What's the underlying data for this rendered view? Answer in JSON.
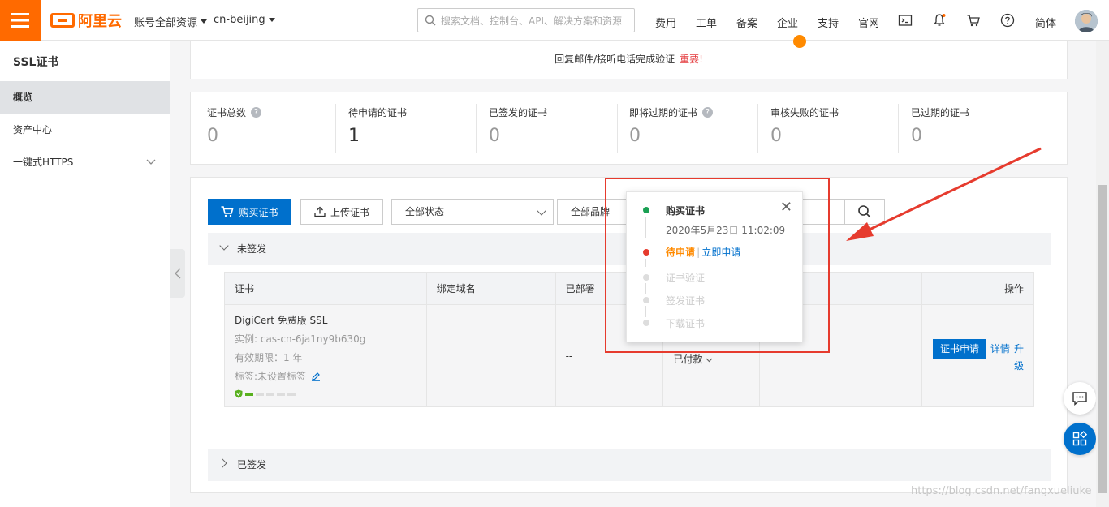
{
  "header": {
    "logo_text": "阿里云",
    "account_scope": "账号全部资源",
    "region": "cn-beijing",
    "search_placeholder": "搜索文档、控制台、API、解决方案和资源",
    "nav": [
      "费用",
      "工单",
      "备案",
      "企业",
      "支持",
      "官网"
    ],
    "language": "简体"
  },
  "sidebar": {
    "title": "SSL证书",
    "items": [
      {
        "label": "概览",
        "active": true
      },
      {
        "label": "资产中心",
        "active": false
      },
      {
        "label": "一键式HTTPS",
        "active": false
      }
    ]
  },
  "notice": {
    "text": "回复邮件/接听电话完成验证",
    "important": "重要!"
  },
  "stats": [
    {
      "label": "证书总数",
      "value": "0",
      "help": true
    },
    {
      "label": "待申请的证书",
      "value": "1",
      "help": false
    },
    {
      "label": "已签发的证书",
      "value": "0",
      "help": false
    },
    {
      "label": "即将过期的证书",
      "value": "0",
      "help": true
    },
    {
      "label": "审核失败的证书",
      "value": "0",
      "help": false
    },
    {
      "label": "已过期的证书",
      "value": "0",
      "help": false
    }
  ],
  "toolbar": {
    "buy_label": "购买证书",
    "upload_label": "上传证书",
    "status_select": "全部状态",
    "brand_select": "全部品牌"
  },
  "groups": {
    "unsigned": "未签发",
    "signed": "已签发"
  },
  "table": {
    "headers": [
      "证书",
      "绑定域名",
      "已部署",
      "",
      "",
      "操作"
    ],
    "row": {
      "name": "DigiCert 免费版 SSL",
      "instance": "实例: cas-cn-6ja1ny9b630g",
      "validity": "有效期限：1 年",
      "tag": "标签:未设置标签",
      "deployed": "--",
      "status": "已付款",
      "apply_btn": "证书申请",
      "detail_link": "详情",
      "upgrade_link": "升级"
    }
  },
  "popover": {
    "steps": [
      {
        "label": "购买证书",
        "state": "done"
      },
      {
        "label": "待申请",
        "state": "current"
      },
      {
        "label": "证书验证",
        "state": "pending"
      },
      {
        "label": "签发证书",
        "state": "pending"
      },
      {
        "label": "下载证书",
        "state": "pending"
      }
    ],
    "timestamp": "2020年5月23日 11:02:09",
    "apply_link": "立即申请"
  },
  "colors": {
    "brand": "#ff6a00",
    "primary": "#0070cc",
    "danger": "#e4393c",
    "current_step": "#ff8a00",
    "done_step": "#1aa053",
    "red_marker": "#e63b2e"
  },
  "watermark": "https://blog.csdn.net/fangxueliuke"
}
